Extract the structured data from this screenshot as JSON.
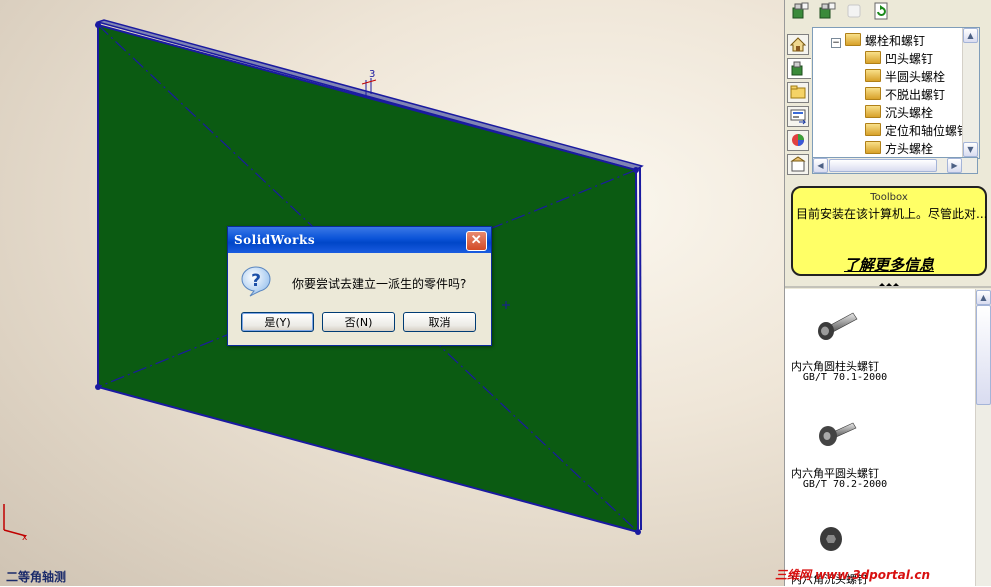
{
  "viewport": {
    "view_label": "二等角轴测",
    "dimension_label": "3"
  },
  "dialog": {
    "title": "SolidWorks",
    "close_glyph": "✕",
    "message": "你要尝试去建立一派生的零件吗?",
    "icon": "question-icon",
    "buttons": [
      {
        "label": "是(Y)"
      },
      {
        "label": "否(N)"
      },
      {
        "label": "取消"
      }
    ]
  },
  "panel": {
    "toolbar_icons": [
      "add-bolt-icon",
      "add-screw-icon",
      "blank-icon",
      "refresh-icon"
    ],
    "tabs": [
      "home-icon",
      "toolbox-icon",
      "folder-icon",
      "palette-icon",
      "appearance-icon",
      "custom-properties-icon"
    ],
    "tree": {
      "parent": "螺栓和螺钉",
      "items": [
        "凹头螺钉",
        "半圆头螺栓",
        "不脱出螺钉",
        "沉头螺栓",
        "定位和轴位螺钉",
        "方头螺栓"
      ]
    },
    "info": {
      "title": "Toolbox",
      "text": "目前安装在该计算机上。尽管此对...",
      "link": "了解更多信息"
    },
    "parts": [
      {
        "name": "内六角圆柱头螺钉",
        "std": "GB/T 70.1-2000"
      },
      {
        "name": "内六角平圆头螺钉",
        "std": "GB/T 70.2-2000"
      },
      {
        "name": "内六角沉头螺钉",
        "std": ""
      }
    ]
  },
  "watermark": "三维网 www.3dportal.cn",
  "colors": {
    "part_face": "#0b5b12",
    "part_edge": "#1a1aa0",
    "dialog_title": "#0a53d8",
    "info_bg": "#ffff66"
  }
}
